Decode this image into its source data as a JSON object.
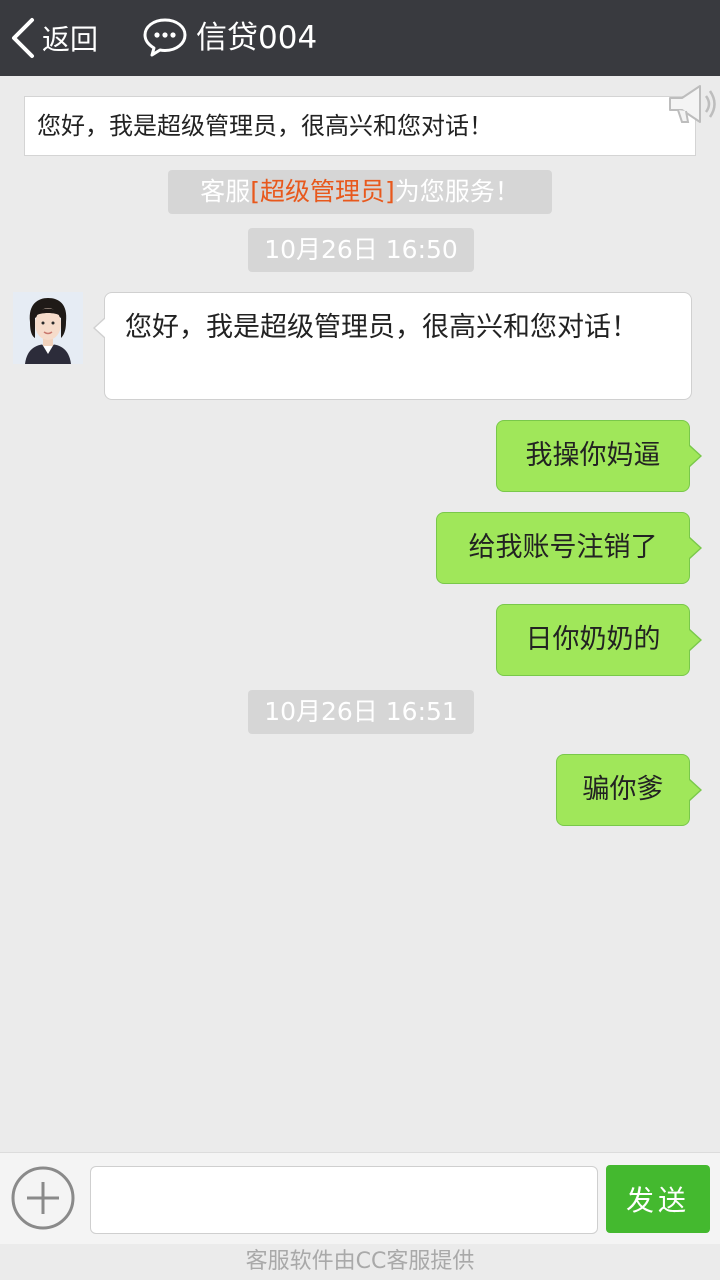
{
  "header": {
    "back_label": "返回",
    "title": "信贷004",
    "icons": {
      "back": "chevron-left-icon",
      "chat": "chat-bubble-icon"
    },
    "background_color": "#393a3f"
  },
  "notice": {
    "text": "您好，我是超级管理员，很高兴和您对话！",
    "icon": "megaphone-icon"
  },
  "system_message": {
    "prefix": "客服",
    "highlight": "[超级管理员]",
    "suffix": "为您服务！",
    "highlight_color": "#e8581c"
  },
  "messages": [
    {
      "type": "time",
      "text": "10月26日 16:50"
    },
    {
      "type": "incoming",
      "sender": "avatar",
      "text": "您好，我是超级管理员，很高兴和您对话！"
    },
    {
      "type": "outgoing",
      "text": "我操你妈逼"
    },
    {
      "type": "outgoing",
      "text": "给我账号注销了"
    },
    {
      "type": "outgoing",
      "text": "日你奶奶的"
    },
    {
      "type": "time",
      "text": "10月26日 16:51"
    },
    {
      "type": "outgoing",
      "text": "骗你爹"
    }
  ],
  "input_bar": {
    "plus_icon": "plus-circle-icon",
    "input_value": "",
    "send_label": "发送",
    "send_color": "#44b92f"
  },
  "footer": {
    "text": "客服软件由CC客服提供"
  },
  "colors": {
    "outgoing_bubble": "#a0e75a",
    "incoming_bubble": "#ffffff",
    "background": "#ebebeb"
  }
}
